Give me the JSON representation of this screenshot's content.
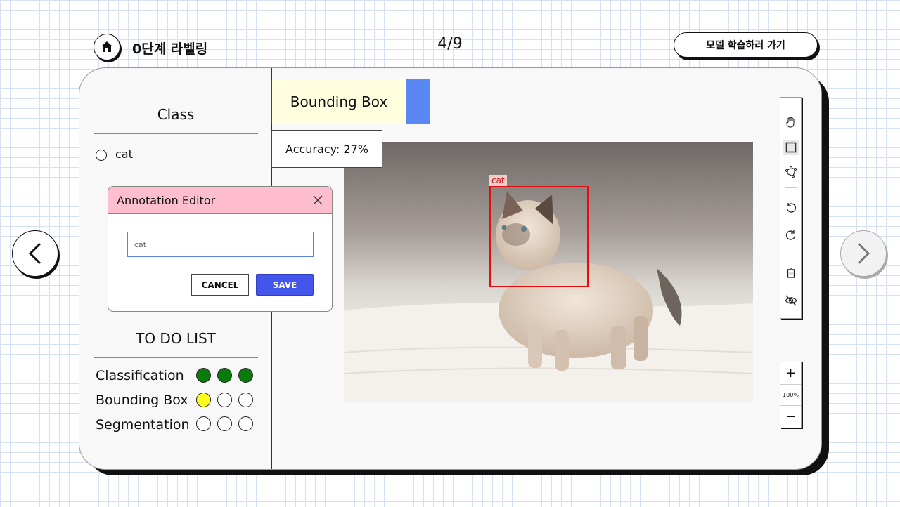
{
  "header": {
    "home_icon": "home-icon",
    "title": "0단계 라벨링",
    "progress": "4/9",
    "train_button": "모델 학습하러 가기"
  },
  "class_panel": {
    "title": "Class",
    "items": [
      {
        "label": "cat"
      }
    ]
  },
  "mode_tab": {
    "label": "Bounding Box",
    "accent_color": "#5987f4"
  },
  "accuracy": "Accuracy: 27%",
  "image": {
    "annotations": [
      {
        "label": "cat",
        "color": "#e01010"
      }
    ]
  },
  "toolbar": {
    "tools": [
      "hand-icon",
      "rectangle-icon",
      "polygon-icon",
      "undo-icon",
      "redo-icon",
      "trash-icon",
      "eye-off-icon"
    ]
  },
  "zoom": {
    "plus": "+",
    "level": "100%",
    "minus": "−"
  },
  "dialog": {
    "title": "Annotation Editor",
    "input_value": "cat",
    "cancel": "CANCEL",
    "save": "SAVE"
  },
  "todo": {
    "title": "TO DO LIST",
    "rows": [
      {
        "label": "Classification",
        "status": [
          "done",
          "done",
          "done"
        ]
      },
      {
        "label": "Bounding Box",
        "status": [
          "current",
          "todo",
          "todo"
        ]
      },
      {
        "label": "Segmentation",
        "status": [
          "todo",
          "todo",
          "todo"
        ]
      }
    ],
    "colors": {
      "done": "#0a7a0a",
      "current": "#ffff1f",
      "todo": "#ffffff"
    }
  }
}
